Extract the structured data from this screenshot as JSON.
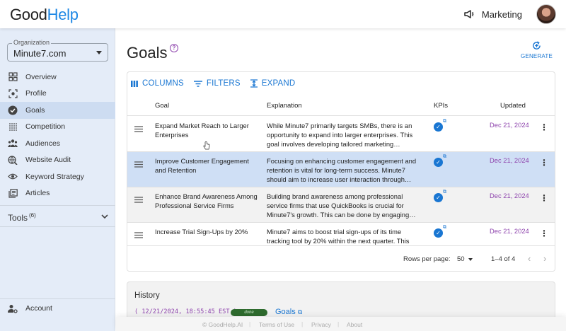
{
  "header": {
    "logo_good": "Good",
    "logo_help": "Help",
    "workspace": "Marketing"
  },
  "sidebar": {
    "org_label": "Organization",
    "org_value": "Minute7.com",
    "items": [
      {
        "label": "Overview",
        "icon": "grid-icon"
      },
      {
        "label": "Profile",
        "icon": "profile-icon"
      },
      {
        "label": "Goals",
        "icon": "check-circle-icon",
        "active": true
      },
      {
        "label": "Competition",
        "icon": "competition-icon"
      },
      {
        "label": "Audiences",
        "icon": "audiences-icon"
      },
      {
        "label": "Website Audit",
        "icon": "website-audit-icon"
      },
      {
        "label": "Keyword Strategy",
        "icon": "keyword-icon"
      },
      {
        "label": "Articles",
        "icon": "articles-icon"
      }
    ],
    "tools_label": "Tools",
    "tools_count": "(6)",
    "account_label": "Account"
  },
  "main": {
    "title": "Goals",
    "generate_label": "GENERATE",
    "toolbar": {
      "columns": "COLUMNS",
      "filters": "FILTERS",
      "expand": "EXPAND"
    },
    "columns": {
      "goal": "Goal",
      "explanation": "Explanation",
      "kpis": "KPIs",
      "updated": "Updated"
    },
    "rows": [
      {
        "goal": "Expand Market Reach to Larger Enterprises",
        "explanation": "While Minute7 primarily targets SMBs, there is an opportunity to expand into larger enterprises. This goal involves developing tailored marketing…",
        "updated": "Dec 21, 2024"
      },
      {
        "goal": "Improve Customer Engagement and Retention",
        "explanation": "Focusing on enhancing customer engagement and retention is vital for long-term success. Minute7 should aim to increase user interaction through…",
        "updated": "Dec 21, 2024"
      },
      {
        "goal": "Enhance Brand Awareness Among Professional Service Firms",
        "explanation": "Building brand awareness among professional service firms that use QuickBooks is crucial for Minute7's growth. This can be done by engaging…",
        "updated": "Dec 21, 2024"
      },
      {
        "goal": "Increase Trial Sign-Ups by 20%",
        "explanation": "Minute7 aims to boost trial sign-ups of its time tracking tool by 20% within the next quarter. This",
        "updated": "Dec 21, 2024"
      }
    ],
    "pagination": {
      "rows_per_page_label": "Rows per page:",
      "rows_per_page": "50",
      "range": "1–4 of 4"
    },
    "history": {
      "title": "History",
      "timestamp": "12/21/2024, 18:55:45 EST",
      "badge": "done",
      "link": "Goals"
    }
  },
  "footer": {
    "copyright": "© GoodHelp.AI",
    "terms": "Terms of Use",
    "privacy": "Privacy",
    "about": "About"
  },
  "colors": {
    "accent": "#1976d2",
    "date": "#8e44ad",
    "sidebar_bg": "#e4ecf8",
    "selected_row": "#cfdff5"
  }
}
